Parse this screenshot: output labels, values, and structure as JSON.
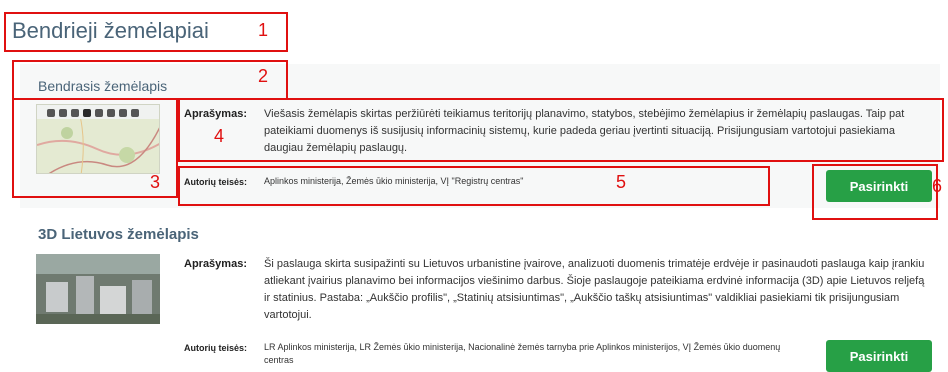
{
  "page_title": "Bendrieji žemėlapiai",
  "services": [
    {
      "title": "Bendrasis žemėlapis",
      "description_label": "Aprašymas:",
      "description": "Viešasis žemėlapis skirtas peržiūrėti teikiamus teritorijų planavimo, statybos, stebėjimo žemėlapius ir žemėlapių paslaugas. Taip pat pateikiami duomenys iš susijusių informacinių sistemų, kurie padeda geriau įvertinti situaciją. Prisijungusiam vartotojui pasiekiama daugiau žemėlapių paslaugų.",
      "rights_label": "Autorių teisės:",
      "rights": "Aplinkos ministerija, Žemės ūkio ministerija, VĮ \"Registrų centras\"",
      "button": "Pasirinkti"
    },
    {
      "title": "3D Lietuvos žemėlapis",
      "description_label": "Aprašymas:",
      "description": "Ši paslauga skirta susipažinti su Lietuvos urbanistine įvairove, analizuoti duomenis trimatėje erdvėje ir pasinaudoti paslauga kaip įrankiu atliekant įvairius planavimo bei informacijos viešinimo darbus. Šioje paslaugoje pateikiama erdvinė informacija (3D) apie Lietuvos reljefą ir statinius. Pastaba: „Aukščio profilis\", „Statinių atsisiuntimas\", „Aukščio taškų atsisiuntimas\" valdikliai pasiekiami tik prisijungusiam vartotojui.",
      "rights_label": "Autorių teisės:",
      "rights": "LR Aplinkos ministerija, LR Žemės ūkio ministerija, Nacionalinė žemės tarnyba prie Aplinkos ministerijos, VĮ Žemės ūkio duomenų centras",
      "button": "Pasirinkti"
    }
  ],
  "annotations": [
    "1",
    "2",
    "3",
    "4",
    "5",
    "6"
  ],
  "colors": {
    "accent": "#27a046",
    "annotation": "#e01010",
    "title": "#4a6478"
  }
}
